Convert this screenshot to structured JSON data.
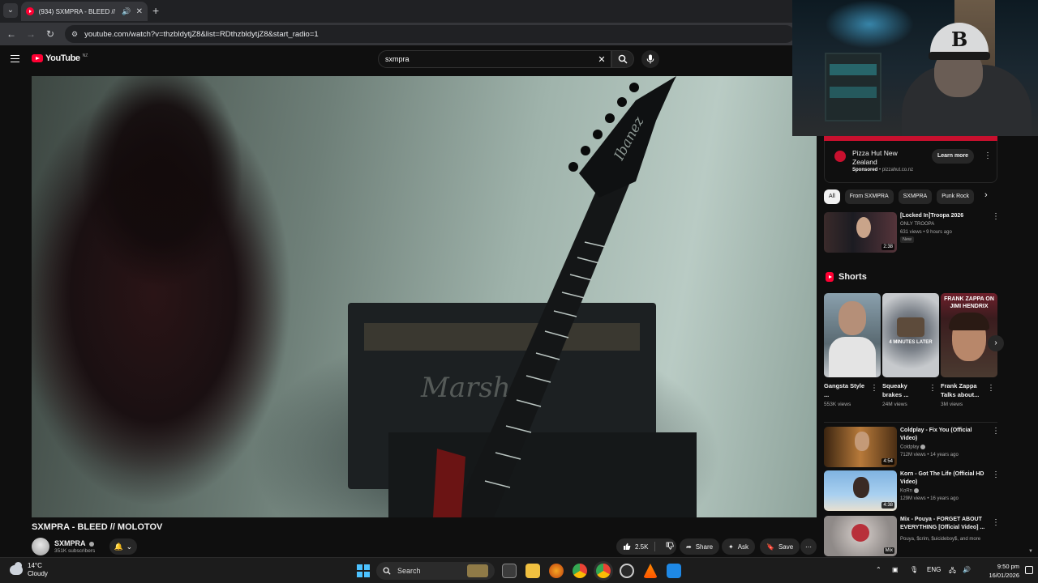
{
  "browser": {
    "tab_title": "(934) SXMPRA - BLEED // M",
    "tab_list_icon": "chevron-down-icon",
    "new_tab_icon": "plus-icon",
    "url": "youtube.com/watch?v=thzbldytjZ8&list=RDthzbldytjZ8&start_radio=1"
  },
  "youtube": {
    "logo_text": "YouTube",
    "logo_country": "NZ",
    "search_query": "sxmpra"
  },
  "video": {
    "amp_brand": "Marshall",
    "guitar_brand": "Ibanez",
    "title": "SXMPRA - BLEED // MOLOTOV",
    "channel_name": "SXMPRA",
    "subscribers": "351K subscribers",
    "likes": "2.5K",
    "share_label": "Share",
    "ask_label": "Ask",
    "save_label": "Save"
  },
  "ad": {
    "title": "Pizza Hut New Zealand",
    "sponsored": "Sponsored",
    "domain": "pizzahut.co.nz",
    "cta": "Learn more"
  },
  "chips": [
    "All",
    "From SXMPRA",
    "SXMPRA",
    "Punk Rock"
  ],
  "recommendations": [
    {
      "title": "[Locked In]Troopa 2026",
      "channel": "ONLY TROOPA",
      "meta": "631 views • 9 hours ago",
      "badge": "New",
      "duration": "2:38"
    },
    {
      "title": "Coldplay - Fix You (Official Video)",
      "channel": "Coldplay",
      "meta": "712M views • 14 years ago",
      "duration": "4:54"
    },
    {
      "title": "Korn - Got The Life (Official HD Video)",
      "channel": "KoRn",
      "meta": "129M views • 16 years ago",
      "duration": "4:38"
    },
    {
      "title": "Mix - Pouya - FORGET ABOUT EVERYTHING [Official Video] ...",
      "channel": "Pouya, $crim, $uicideboy$, and more",
      "badge": "Mix"
    }
  ],
  "shorts": {
    "heading": "Shorts",
    "items": [
      {
        "title": "Gangsta Style ...",
        "views": "553K views"
      },
      {
        "title": "Squeaky brakes ...",
        "views": "24M views",
        "overlay": "4 MINUTES LATER"
      },
      {
        "title": "Frank Zappa Talks about...",
        "views": "3M views",
        "overlay": "FRANK ZAPPA ON JIMI HENDRIX"
      }
    ]
  },
  "taskbar": {
    "temperature": "14°C",
    "condition": "Cloudy",
    "search_label": "Search",
    "language": "ENG",
    "time": "9:50 pm",
    "date": "16/01/2026"
  },
  "colors": {
    "yt_red": "#ff0033",
    "pizza_red": "#c8102e",
    "windows_blue": "#4cc2ff"
  }
}
